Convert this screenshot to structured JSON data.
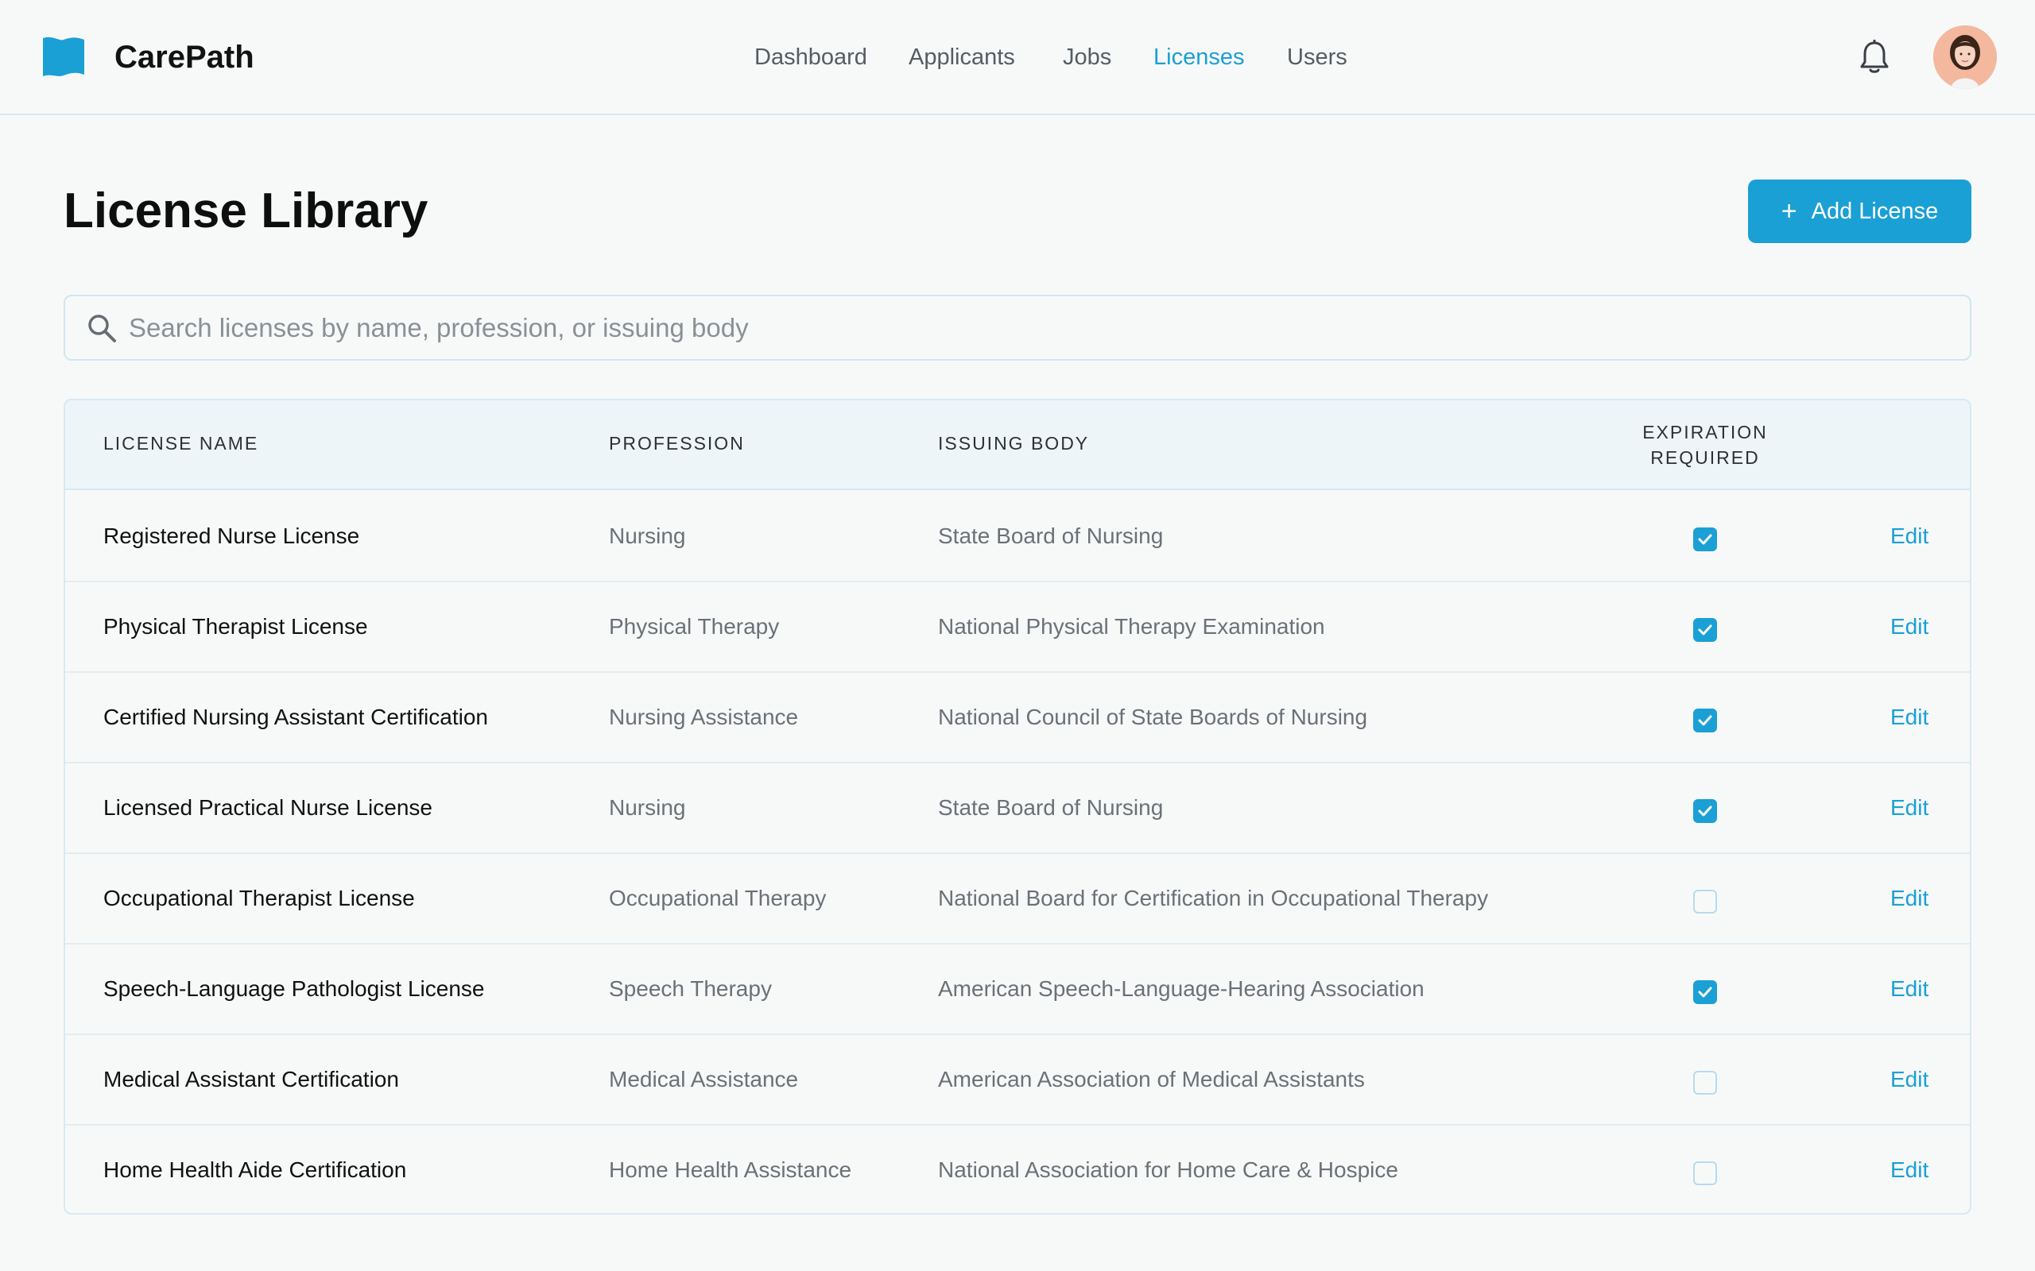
{
  "app": {
    "brand": "CarePath"
  },
  "nav": {
    "items": [
      {
        "label": "Dashboard",
        "active": false
      },
      {
        "label": "Applicants",
        "active": false
      },
      {
        "label": "Jobs",
        "active": false
      },
      {
        "label": "Licenses",
        "active": true
      },
      {
        "label": "Users",
        "active": false
      }
    ]
  },
  "header": {
    "icons": [
      "flag-logo-icon",
      "bell-icon",
      "avatar"
    ]
  },
  "page": {
    "title": "License Library",
    "add_button": {
      "icon": "+",
      "label": "Add License"
    }
  },
  "search": {
    "placeholder": "Search licenses by name, profession, or issuing body",
    "value": ""
  },
  "table": {
    "columns": {
      "name": "LICENSE NAME",
      "profession": "PROFESSION",
      "issuing_body": "ISSUING BODY",
      "expiration_line1": "EXPIRATION",
      "expiration_line2": "REQUIRED"
    },
    "edit_label": "Edit",
    "rows": [
      {
        "name": "Registered Nurse License",
        "profession": "Nursing",
        "issuing_body": "State Board of Nursing",
        "expiration_required": true
      },
      {
        "name": "Physical Therapist License",
        "profession": "Physical Therapy",
        "issuing_body": "National Physical Therapy Examination",
        "expiration_required": true
      },
      {
        "name": "Certified Nursing Assistant Certification",
        "profession": "Nursing Assistance",
        "issuing_body": "National Council of State Boards of Nursing",
        "expiration_required": true
      },
      {
        "name": "Licensed Practical Nurse License",
        "profession": "Nursing",
        "issuing_body": "State Board of Nursing",
        "expiration_required": true
      },
      {
        "name": "Occupational Therapist License",
        "profession": "Occupational Therapy",
        "issuing_body": "National Board for Certification in Occupational Therapy",
        "expiration_required": false
      },
      {
        "name": "Speech-Language Pathologist License",
        "profession": "Speech Therapy",
        "issuing_body": "American Speech-Language-Hearing Association",
        "expiration_required": true
      },
      {
        "name": "Medical Assistant Certification",
        "profession": "Medical Assistance",
        "issuing_body": "American Association of Medical Assistants",
        "expiration_required": false
      },
      {
        "name": "Home Health Aide Certification",
        "profession": "Home Health Assistance",
        "issuing_body": "National Association for Home Care & Hospice",
        "expiration_required": false
      }
    ]
  },
  "colors": {
    "accent": "#1aa0d4",
    "background": "#f7f9f9",
    "header_row": "#edf5f9",
    "border": "#d7e9f2",
    "muted_text": "#6b7177"
  }
}
